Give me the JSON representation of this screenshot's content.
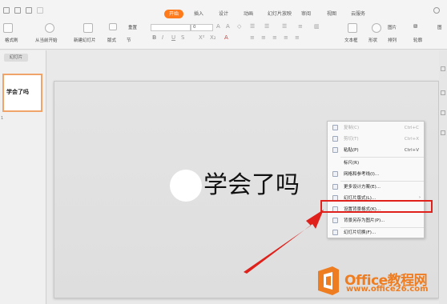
{
  "tabs": [
    {
      "label": "开始",
      "active": true
    },
    {
      "label": "插入"
    },
    {
      "label": "设计"
    },
    {
      "label": "动画"
    },
    {
      "label": "幻灯片放映"
    },
    {
      "label": "审阅"
    },
    {
      "label": "视图"
    },
    {
      "label": "云服务"
    }
  ],
  "ribbon": {
    "format_brush": "格式刷",
    "play_from_current": "从当前开始",
    "new_slide": "新建幻灯片",
    "layout": "版式",
    "section": "节",
    "reset": "重置",
    "font_size": "0",
    "text_box": "文本框",
    "shape": "形状",
    "arrange": "排列",
    "picture": "图片",
    "outline": "轮廓",
    "right_cut": "图"
  },
  "left_panel": {
    "tab_label": "幻灯片",
    "slide_number": "1",
    "thumb_text": "学会了吗"
  },
  "slide": {
    "title": "学会了吗"
  },
  "context_menu": {
    "items": [
      {
        "label": "复制(C)",
        "shortcut": "Ctrl+C",
        "icon": "copy-icon",
        "disabled": true
      },
      {
        "label": "剪切(T)",
        "shortcut": "Ctrl+X",
        "icon": "cut-icon",
        "disabled": true
      },
      {
        "label": "粘贴(P)",
        "shortcut": "Ctrl+V",
        "icon": "paste-icon"
      },
      {
        "label": "标尺(R)",
        "shortcut": "",
        "icon": ""
      },
      {
        "label": "网格和参考线(I)...",
        "shortcut": "",
        "icon": "grid-icon"
      },
      {
        "label": "更多设计方案(E)...",
        "shortcut": "",
        "icon": "design-icon"
      },
      {
        "label": "幻灯片版式(L)...",
        "shortcut": "",
        "icon": "layout-icon",
        "submenu": "›"
      },
      {
        "label": "设置背景格式(K)...",
        "shortcut": "",
        "icon": "background-icon",
        "highlighted": true
      },
      {
        "label": "背景另存为图片(P)...",
        "shortcut": "",
        "icon": "save-image-icon"
      },
      {
        "label": "幻灯片切换(F)...",
        "shortcut": "",
        "icon": "transition-icon"
      }
    ]
  },
  "watermark": {
    "brand": "Office教程网",
    "url": "www.office26.com"
  },
  "colors": {
    "accent": "#ff7a1a",
    "highlight_box": "#e0201a",
    "arrow": "#e0201a",
    "watermark": "#ee7d22"
  }
}
